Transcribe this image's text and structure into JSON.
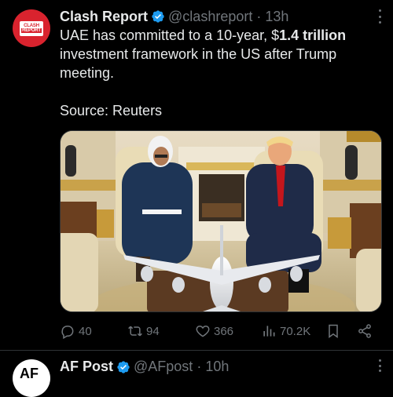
{
  "tweet": {
    "author_name": "Clash Report",
    "handle": "@clashreport",
    "separator": "·",
    "time": "13h",
    "avatar_text_line1": "CLASH",
    "avatar_text_line2": "REPORT",
    "text_before_bold": "UAE has committed to a 10-year, $",
    "text_bold": "1.4 trillion",
    "text_after_bold": " investment framework in the US after Trump meeting.",
    "source_line": "Source: Reuters",
    "image_icon": "photo-oval-office-meeting"
  },
  "actions": {
    "replies": "40",
    "retweets": "94",
    "likes": "366",
    "views": "70.2K"
  },
  "next_tweet": {
    "author_name": "AF Post",
    "handle": "@AFpost",
    "separator": "·",
    "time": "10h",
    "avatar_text": "AF"
  },
  "colors": {
    "background": "#000000",
    "text": "#e7e9ea",
    "muted": "#71767b",
    "verified": "#1d9bf0",
    "brand_red": "#d9232e",
    "divider": "#2f3336"
  }
}
